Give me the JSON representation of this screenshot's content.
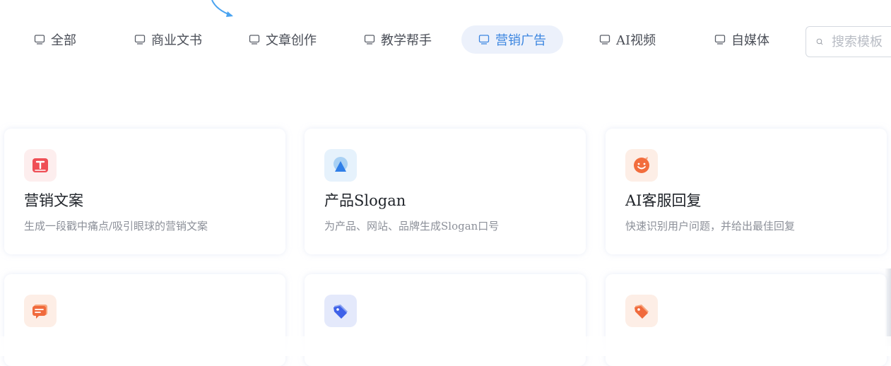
{
  "tabs": [
    {
      "label": "全部",
      "active": false
    },
    {
      "label": "商业文书",
      "active": false
    },
    {
      "label": "文章创作",
      "active": false
    },
    {
      "label": "教学帮手",
      "active": false
    },
    {
      "label": "营销广告",
      "active": true
    },
    {
      "label": "AI视频",
      "active": false
    },
    {
      "label": "自媒体",
      "active": false
    }
  ],
  "search": {
    "placeholder": "搜索模板",
    "value": ""
  },
  "cards": [
    {
      "title": "营销文案",
      "desc": "生成一段戳中痛点/吸引眼球的营销文案",
      "icon": "text-t-icon"
    },
    {
      "title": "产品Slogan",
      "desc": "为产品、网站、品牌生成Slogan口号",
      "icon": "slogan-icon"
    },
    {
      "title": "AI客服回复",
      "desc": "快速识别用户问题，并给出最佳回复",
      "icon": "smile-chat-icon"
    },
    {
      "title": "",
      "desc": "",
      "icon": "message-icon"
    },
    {
      "title": "",
      "desc": "",
      "icon": "blue-tag-icon"
    },
    {
      "title": "",
      "desc": "",
      "icon": "orange-tag-icon"
    }
  ],
  "colors": {
    "accent": "#3c86e0",
    "active_tab_bg": "#ecf1fb",
    "tab_text": "#4a4e57",
    "card_title": "#1f2329",
    "card_desc": "#8c9099"
  }
}
